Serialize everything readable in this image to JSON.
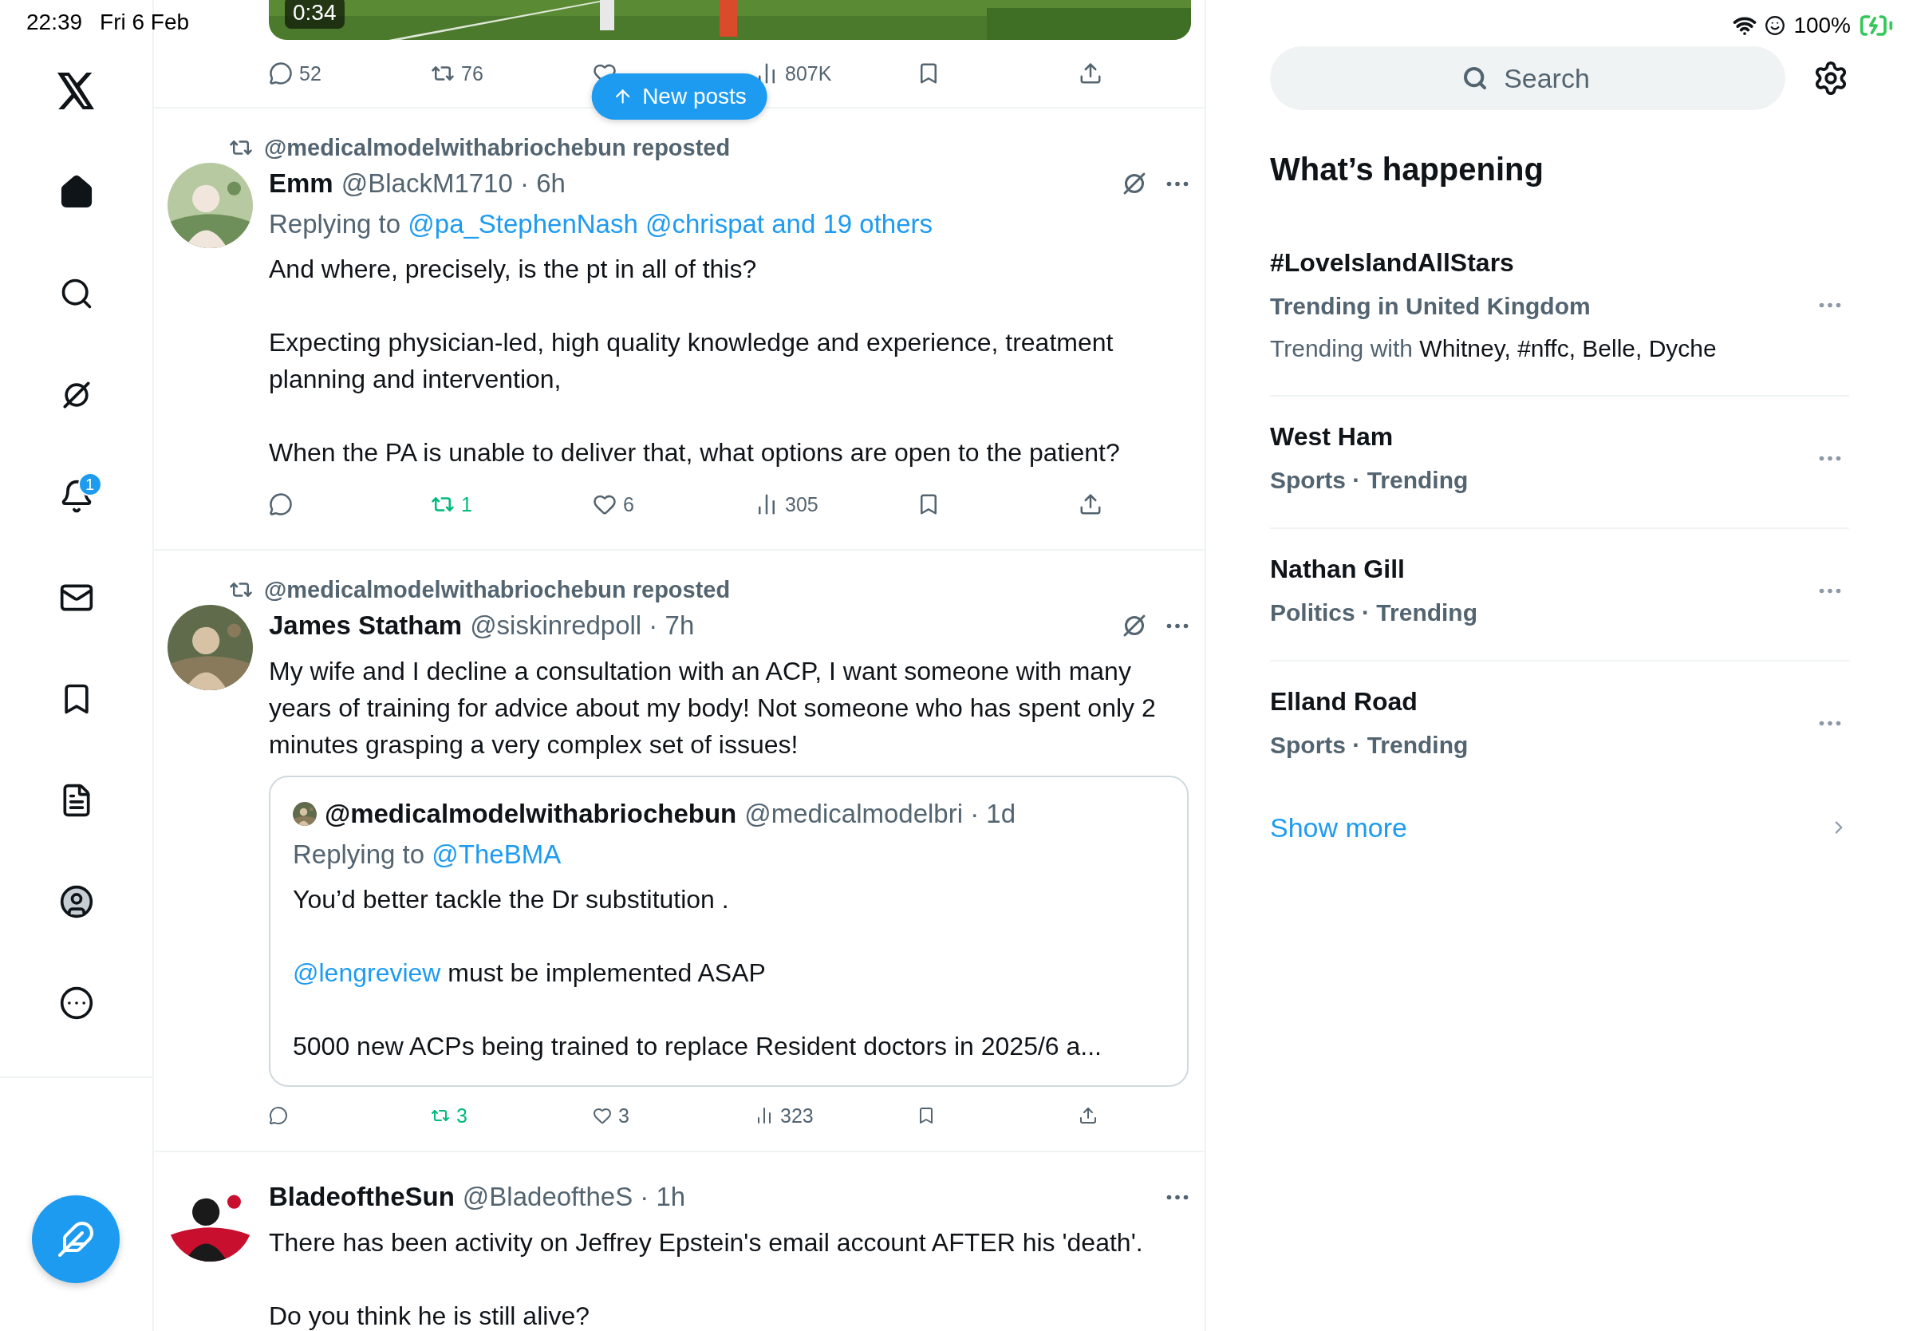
{
  "status_bar": {
    "time": "22:39",
    "date": "Fri 6 Feb",
    "battery": "100%"
  },
  "nav": {
    "items": [
      {
        "kind": "home",
        "selected": true
      },
      {
        "kind": "search",
        "selected": false
      },
      {
        "kind": "grok",
        "selected": false
      },
      {
        "kind": "notifications",
        "selected": false,
        "badge": "1"
      },
      {
        "kind": "messages",
        "selected": false
      },
      {
        "kind": "bookmarks",
        "selected": false
      },
      {
        "kind": "lists",
        "selected": false
      },
      {
        "kind": "profile",
        "selected": false
      },
      {
        "kind": "more",
        "selected": false
      }
    ]
  },
  "top_post": {
    "video": {
      "kind": "picture",
      "duration": "0:34"
    },
    "actions": [
      {
        "kind": "reply",
        "count": "52"
      },
      {
        "kind": "repost",
        "count": "76",
        "active": false
      },
      {
        "kind": "like",
        "active": false
      },
      {
        "kind": "views",
        "count": "807K"
      },
      {
        "kind": "bookmark"
      },
      {
        "kind": "share"
      }
    ]
  },
  "new_posts_button": "New posts",
  "posts": [
    {
      "reposted_by": "@medicalmodelwithabriochebun reposted",
      "name": "Emm",
      "meta": "@BlackM1710 · 6h",
      "grok_button": true,
      "replying_to": {
        "prefix": "Replying to",
        "mentions": "@pa_StephenNash @chrispat and 19 others"
      },
      "paragraphs": [
        {
          "text": "And where, precisely, is the pt in all of this?"
        },
        {
          "text": "Expecting physician-led, high quality knowledge and  experience, treatment planning and intervention,"
        },
        {
          "text": "When the PA is unable to deliver that, what options are open to the patient?"
        }
      ],
      "actions": [
        {
          "kind": "reply"
        },
        {
          "kind": "repost",
          "count": "1",
          "active": true
        },
        {
          "kind": "like",
          "count": "6",
          "active": false
        },
        {
          "kind": "views",
          "count": "305"
        },
        {
          "kind": "bookmark"
        },
        {
          "kind": "share"
        }
      ]
    },
    {
      "reposted_by": "@medicalmodelwithabriochebun reposted",
      "name": "James Statham",
      "meta": "@siskinredpoll · 7h",
      "grok_button": true,
      "paragraphs": [
        {
          "text": "My wife and I decline a consultation with an ACP, I want someone with many years of training for advice about my body! Not someone who has spent only 2 minutes grasping a very complex set of issues!"
        }
      ],
      "quote": {
        "name": "@medicalmodelwithabriochebun",
        "meta": "@medicalmodelbri · 1d",
        "replying_to": {
          "prefix": "Replying to",
          "mentions": "@TheBMA"
        },
        "paragraphs": [
          {
            "text": "You’d better tackle the Dr substitution ."
          },
          {
            "mention": "@lengreview",
            "text": " must be implemented ASAP"
          },
          {
            "text": "5000 new ACPs being trained to replace Resident doctors in 2025/6 a..."
          }
        ]
      },
      "actions": [
        {
          "kind": "reply"
        },
        {
          "kind": "repost",
          "count": "3",
          "active": true
        },
        {
          "kind": "like",
          "count": "3",
          "active": false
        },
        {
          "kind": "views",
          "count": "323"
        },
        {
          "kind": "bookmark"
        },
        {
          "kind": "share"
        }
      ]
    },
    {
      "name": "BladeoftheSun",
      "meta": "@BladeoftheS · 1h",
      "grok_button": false,
      "paragraphs": [
        {
          "text": "There has been activity on Jeffrey Epstein's email account AFTER his 'death'."
        },
        {
          "text": "Do you think he is still alive?"
        }
      ]
    }
  ],
  "sidebar": {
    "search": {
      "placeholder": "Search"
    },
    "heading": "What’s happening",
    "trends": [
      {
        "title": "#LoveIslandAllStars",
        "subtitle": "Trending in United Kingdom",
        "extra": {
          "prefix": "Trending with",
          "names": "Whitney, #nffc, Belle, Dyche"
        }
      },
      {
        "title": "West Ham",
        "subtitle": "Sports · Trending"
      },
      {
        "title": "Nathan Gill",
        "subtitle": "Politics · Trending"
      },
      {
        "title": "Elland Road",
        "subtitle": "Sports · Trending"
      }
    ],
    "show_more": "Show more"
  }
}
